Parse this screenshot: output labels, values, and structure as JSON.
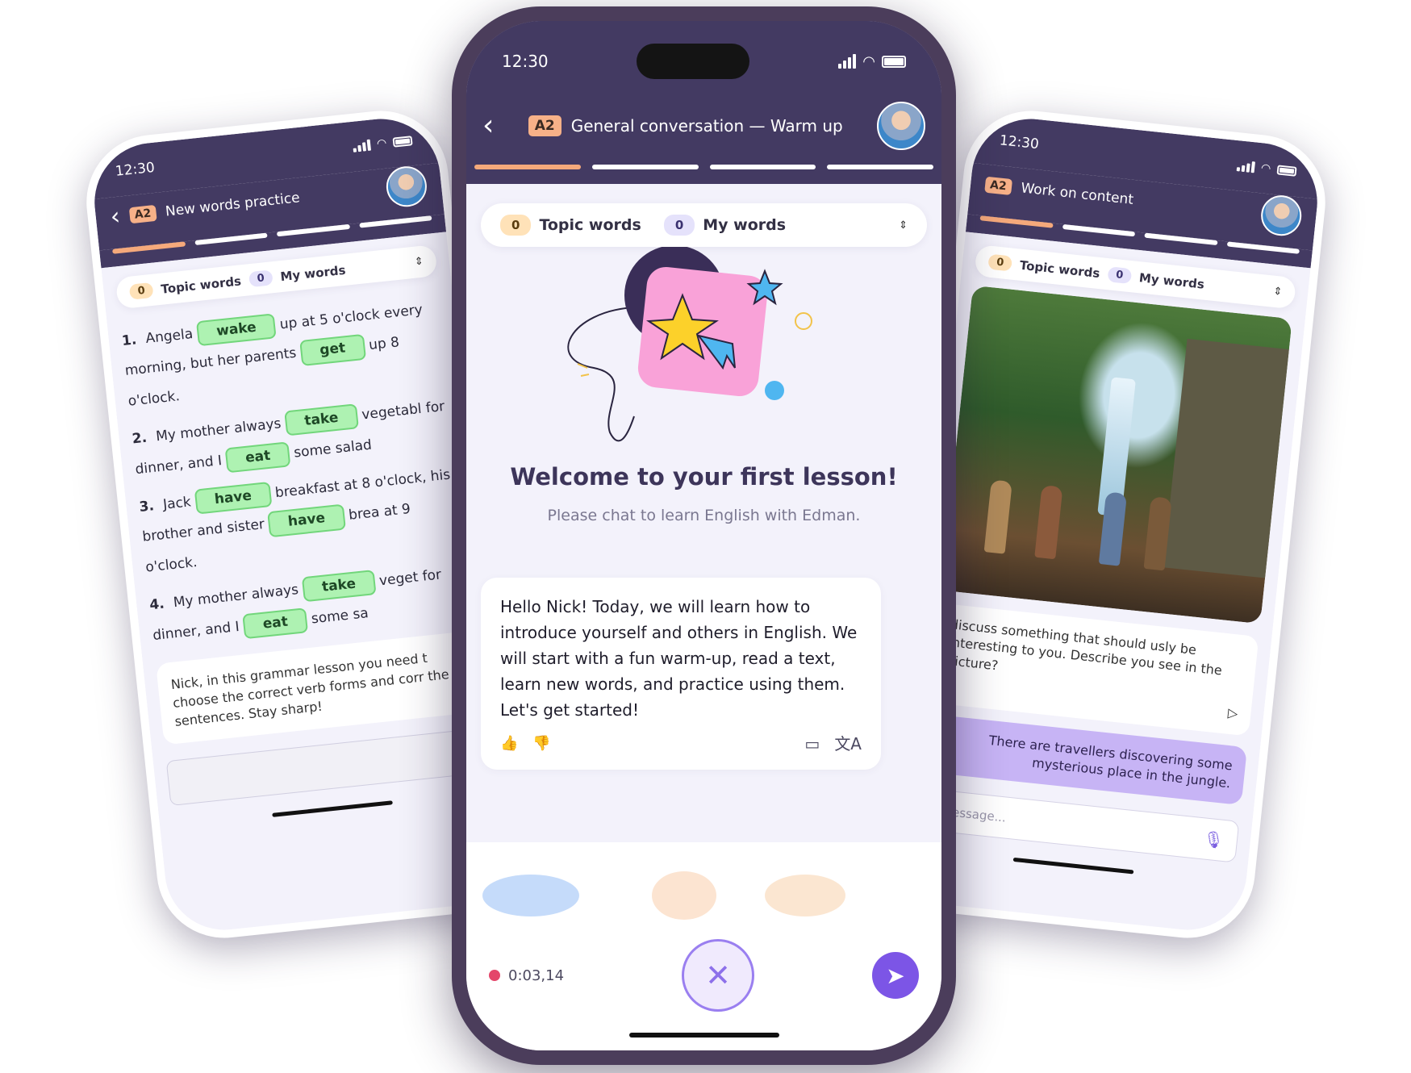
{
  "colors": {
    "header_bg": "#433a62",
    "accent_orange": "#f5a97b",
    "chip_green": "#aef2b2",
    "user_bubble": "#c7b4f5",
    "send_purple": "#7c55e6",
    "record_red": "#e4466a"
  },
  "left_phone": {
    "time": "12:30",
    "level": "A2",
    "title": "New words practice",
    "topic_count": "0",
    "topic_label": "Topic words",
    "my_count": "0",
    "my_label": "My words",
    "exercises": [
      {
        "num": "1.",
        "parts": [
          "Angela",
          "wake",
          "up at 5 o'clock every",
          "morning, but her parents",
          "get",
          "up",
          "8 o'clock."
        ]
      },
      {
        "num": "2.",
        "parts": [
          "My mother always",
          "take",
          "vegetabl",
          "for dinner, and I",
          "eat",
          "some salad"
        ]
      },
      {
        "num": "3.",
        "parts": [
          "Jack",
          "have",
          "breakfast at 8 o'clock,",
          "his brother and sister",
          "have",
          "brea",
          "at 9 o'clock."
        ]
      },
      {
        "num": "4.",
        "parts": [
          "My mother always",
          "take",
          "veget",
          "for dinner, and I",
          "eat",
          "some sa"
        ]
      }
    ],
    "bot_message": "Nick, in this grammar lesson you need t choose the correct verb forms and corr the sentences. Stay sharp!"
  },
  "center_phone": {
    "time": "12:30",
    "level": "A2",
    "title": "General conversation — Warm up",
    "topic_count": "0",
    "topic_label": "Topic words",
    "my_count": "0",
    "my_label": "My words",
    "welcome": "Welcome to your first lesson!",
    "subtitle": "Please chat to learn English with Edman.",
    "bot_message": "Hello Nick! Today, we will learn how to introduce yourself and others in English. We will start with a fun warm-up, read a text, learn new words, and practice using them.\nLet's get started!",
    "record_time": "0:03,14",
    "icons": {
      "back": "chevron-left-icon",
      "like": "thumbs-up-icon",
      "dislike": "thumbs-down-icon",
      "no_subtitles": "subtitles-off-icon",
      "translate": "translate-icon",
      "cancel": "close-icon",
      "send": "send-icon"
    }
  },
  "right_phone": {
    "time": "12:30",
    "level": "A2",
    "title": "Work on content",
    "topic_count": "0",
    "topic_label": "Topic words",
    "my_count": "0",
    "my_label": "My words",
    "bot_message": "discuss something that should usly be interesting to you. Describe you see in the picture?",
    "user_message": "There are travellers discovering some mysterious place in the jungle.",
    "input_placeholder": "r message..."
  }
}
